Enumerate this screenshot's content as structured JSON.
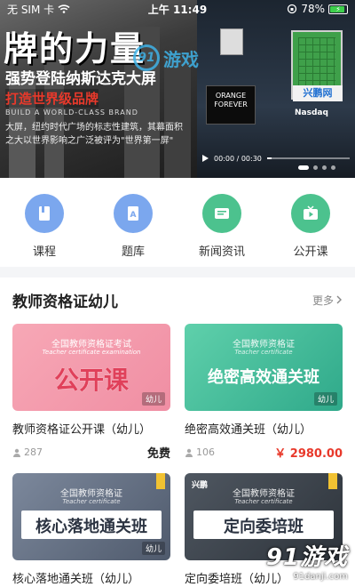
{
  "status_bar": {
    "carrier": "无 SIM 卡",
    "time": "上午 11:49",
    "battery": "78%"
  },
  "banner": {
    "big_title": "牌的力量",
    "line1": "强势登陆纳斯达克大屏",
    "line2": "打造世界级品牌",
    "line3": "BUILD A WORLD-CLASS BRAND",
    "description": "大屏，纽约时代广场的标志性建筑，其幕面积之大以世界影响之广泛被评为\"世界第一屏\"",
    "screen_text_1": "ORANGE FOREVER",
    "board_label": "兴鹏网",
    "board_sub": "Nasdaq",
    "watermark": "游戏",
    "watermark_ring": "91",
    "video_time": "00:00 / 00:30",
    "dots": 4,
    "active_dot": 0
  },
  "categories": [
    {
      "label": "课程",
      "icon": "book-icon",
      "color": "#7ba7ee"
    },
    {
      "label": "题库",
      "icon": "question-bank-icon",
      "color": "#7ba7ee"
    },
    {
      "label": "新闻资讯",
      "icon": "news-icon",
      "color": "#4cc28e"
    },
    {
      "label": "公开课",
      "icon": "tv-icon",
      "color": "#4cc28e"
    }
  ],
  "section": {
    "title": "教师资格证幼儿",
    "more": "更多"
  },
  "courses": [
    {
      "thumb_sub": "全国教师资格证考试",
      "thumb_sub2": "Teacher certificate examination",
      "thumb_main": "公开课",
      "tag": "幼儿",
      "name": "教师资格证公开课（幼儿）",
      "count": "287",
      "price": "免费"
    },
    {
      "thumb_sub": "全国教师资格证",
      "thumb_sub2": "Teacher certificate",
      "thumb_main": "绝密高效通关班",
      "tag": "幼儿",
      "name": "绝密高效通关班（幼儿）",
      "count": "106",
      "price": "￥ 2980.00"
    },
    {
      "thumb_sub": "全国教师资格证",
      "thumb_sub2": "Teacher certificate",
      "thumb_main": "核心落地通关班",
      "tag": "幼儿",
      "name": "核心落地通关班（幼儿）",
      "count": "",
      "price": ""
    },
    {
      "brand": "兴鹏",
      "thumb_sub": "全国教师资格证",
      "thumb_sub2": "Teacher certificate",
      "thumb_main": "定向委培班",
      "tag": "",
      "name": "定向委培班（幼儿）",
      "count": "",
      "price": ""
    }
  ],
  "site_watermark": {
    "big": "91游戏",
    "small": "91danji.com"
  }
}
